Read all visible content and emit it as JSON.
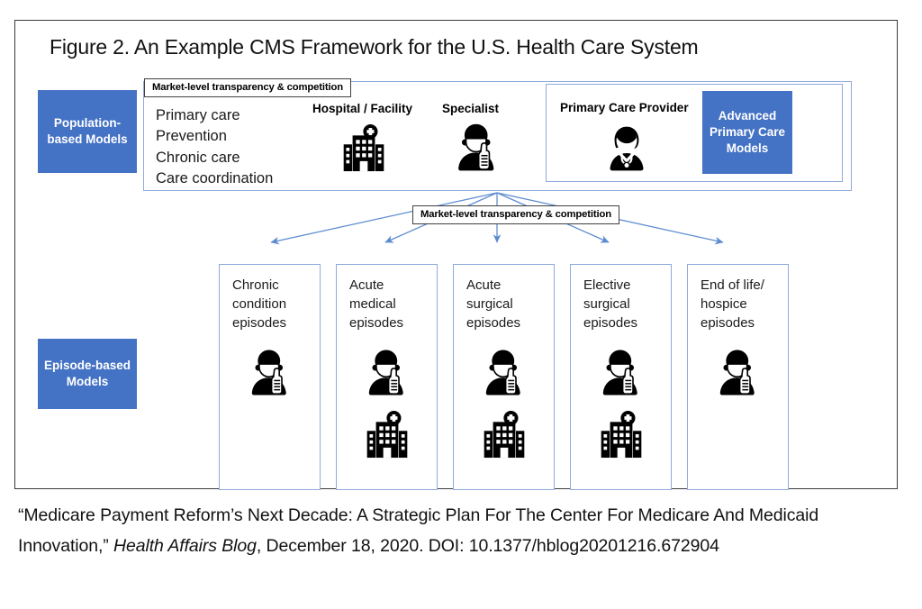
{
  "figure": {
    "title": "Figure 2. An Example CMS Framework for the U.S. Health Care System",
    "accent_blue": "#4472C4",
    "box_border_blue": "#8faadc",
    "frame_border": "#3a3a3a"
  },
  "population_band": {
    "models_box_label": "Population-based Models",
    "market_tag": "Market-level transparency & competition",
    "services": [
      "Primary care",
      "Prevention",
      "Chronic care",
      "Care coordination"
    ],
    "columns": [
      {
        "header": "Hospital / Facility",
        "icon": "hospital-icon"
      },
      {
        "header": "Specialist",
        "icon": "specialist-doctor-icon"
      }
    ],
    "pcp_group": {
      "header": "Primary Care Provider",
      "icon": "primary-care-provider-icon",
      "models_box_label": "Advanced Primary Care Models"
    }
  },
  "middle": {
    "market_tag": "Market-level transparency & competition",
    "arrow_count": 5
  },
  "episode_band": {
    "models_box_label": "Episode-based Models",
    "episodes": [
      {
        "label": "Chronic condition episodes",
        "icons": [
          "specialist-doctor-icon"
        ]
      },
      {
        "label": "Acute medical episodes",
        "icons": [
          "specialist-doctor-icon",
          "hospital-icon"
        ]
      },
      {
        "label": "Acute surgical episodes",
        "icons": [
          "specialist-doctor-icon",
          "hospital-icon"
        ]
      },
      {
        "label": "Elective surgical episodes",
        "icons": [
          "specialist-doctor-icon",
          "hospital-icon"
        ]
      },
      {
        "label": "End of life/ hospice episodes",
        "icons": [
          "specialist-doctor-icon"
        ]
      }
    ]
  },
  "caption": {
    "line1": "“Medicare Payment Reform’s Next Decade: A Strategic Plan For The Center For Medicare And Medicaid",
    "line2_pre": "Innovation,” ",
    "line2_italic": "Health Affairs Blog",
    "line2_post": ", December 18, 2020. DOI: 10.1377/hblog20201216.672904"
  }
}
